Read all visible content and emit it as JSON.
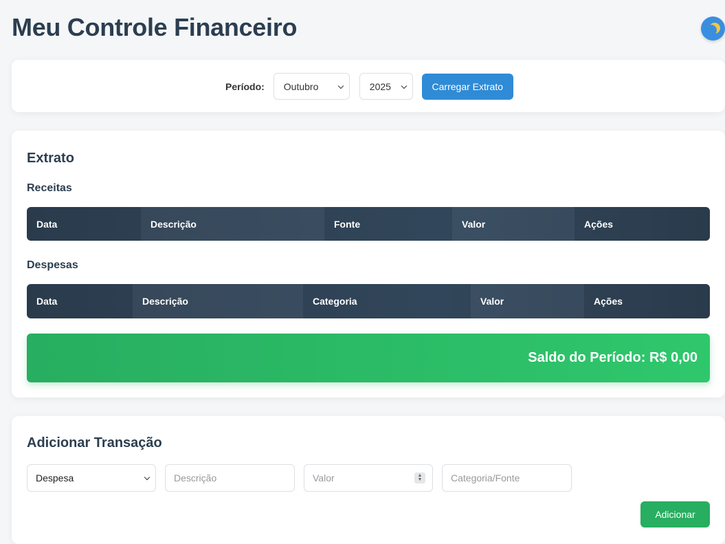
{
  "header": {
    "title": "Meu Controle Financeiro",
    "theme_icon": "moon-icon"
  },
  "period": {
    "label": "Período:",
    "month": "Outubro",
    "year": "2025",
    "load_button": "Carregar Extrato"
  },
  "extract": {
    "title": "Extrato",
    "income": {
      "title": "Receitas",
      "columns": [
        "Data",
        "Descrição",
        "Fonte",
        "Valor",
        "Ações"
      ],
      "rows": []
    },
    "expenses": {
      "title": "Despesas",
      "columns": [
        "Data",
        "Descrição",
        "Categoria",
        "Valor",
        "Ações"
      ],
      "rows": []
    },
    "balance": "Saldo do Período: R$ 0,00"
  },
  "add_transaction": {
    "title": "Adicionar Transação",
    "type_value": "Despesa",
    "description_placeholder": "Descrição",
    "value_placeholder": "Valor",
    "category_placeholder": "Categoria/Fonte",
    "submit_button": "Adicionar"
  },
  "colors": {
    "primary": "#2f8bd6",
    "header_dark": "#2c3e50",
    "success": "#27ae60"
  }
}
